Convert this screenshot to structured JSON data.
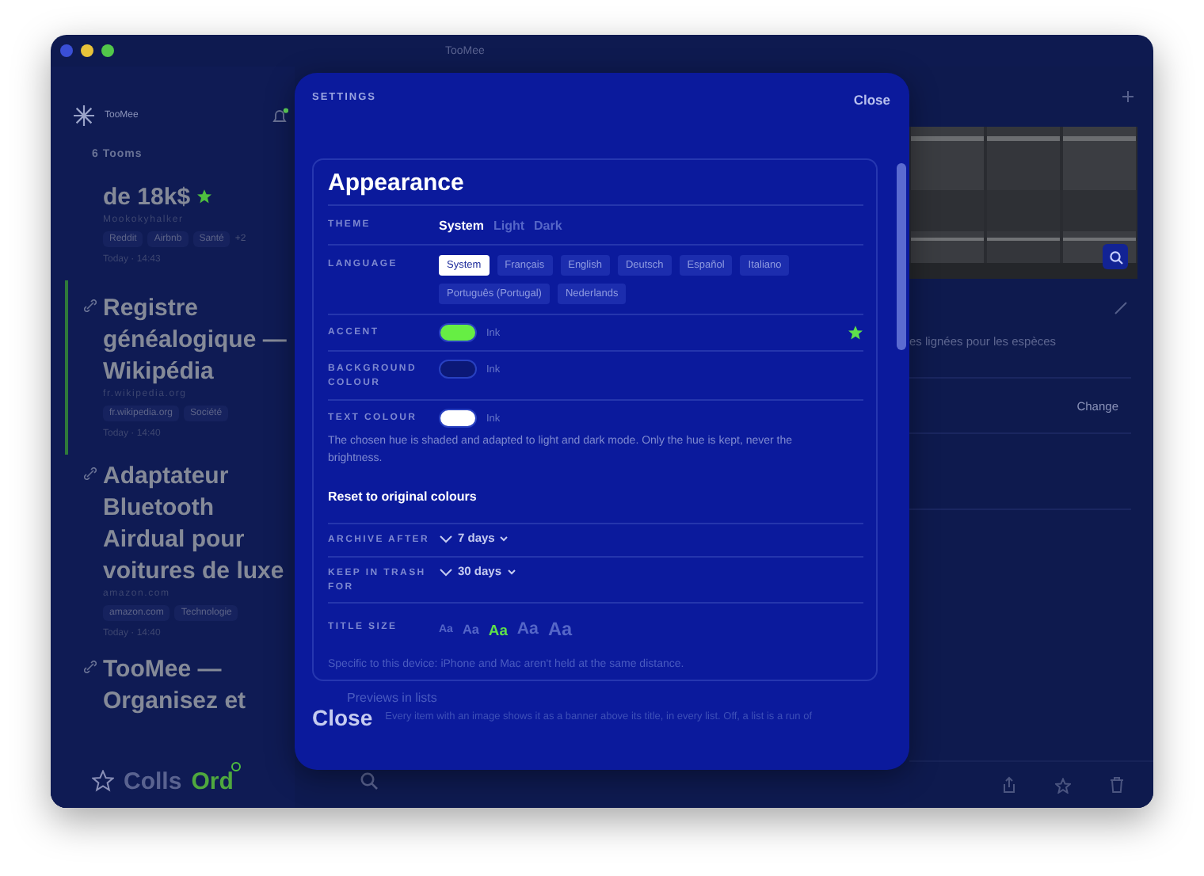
{
  "window": {
    "title": "TooMee"
  },
  "sidebar": {
    "app_name": "TooMee",
    "notification": true,
    "count": "6 Tooms",
    "items": [
      {
        "title": "de 18k$",
        "starred": true,
        "source": "Mookokyhalker",
        "tags": [
          "Reddit",
          "Airbnb",
          "Santé",
          "+2"
        ],
        "time": "Today · 14:43",
        "selected": false
      },
      {
        "title": "Registre généalogique — Wikipédia",
        "starred": false,
        "source": "fr.wikipedia.org",
        "tags": [
          "fr.wikipedia.org",
          "Société"
        ],
        "time": "Today · 14:40",
        "selected": true
      },
      {
        "title": "Adaptateur Bluetooth Airdual pour voitures de luxe",
        "starred": false,
        "source": "amazon.com",
        "tags": [
          "amazon.com",
          "Technologie"
        ],
        "time": "Today · 14:40",
        "selected": false
      },
      {
        "title": "TooMee — Organisez et",
        "starred": false,
        "selected": false
      }
    ],
    "tabs": [
      {
        "label": "Colls",
        "selected": false,
        "badge": false
      },
      {
        "label": "Ord",
        "selected": true,
        "badge": true
      }
    ]
  },
  "detail": {
    "text": "es lignées pour les espèces",
    "action": "Change"
  },
  "settings": {
    "title": "SETTINGS",
    "close": "Close",
    "section": "Appearance",
    "theme": {
      "label": "THEME",
      "options": [
        {
          "label": "System",
          "selected": true
        },
        {
          "label": "Light",
          "selected": false
        },
        {
          "label": "Dark",
          "selected": false
        }
      ]
    },
    "language": {
      "label": "LANGUAGE",
      "options": [
        {
          "label": "System",
          "selected": true
        },
        {
          "label": "Français",
          "selected": false
        },
        {
          "label": "English",
          "selected": false
        },
        {
          "label": "Deutsch",
          "selected": false
        },
        {
          "label": "Español",
          "selected": false
        },
        {
          "label": "Italiano",
          "selected": false
        },
        {
          "label": "Português (Portugal)",
          "selected": false
        },
        {
          "label": "Nederlands",
          "selected": false
        }
      ]
    },
    "colours": [
      {
        "label": "ACCENT",
        "color": "#66ee44",
        "value": "Ink",
        "starred": true
      },
      {
        "label": "BACKGROUND COLOUR",
        "color": "#0b1877",
        "value": "Ink",
        "starred": false
      },
      {
        "label": "TEXT COLOUR",
        "color": "#ffffff",
        "value": "Ink",
        "starred": false
      }
    ],
    "colour_note": "The chosen hue is shaded and adapted to light and dark mode. Only the hue is kept, never the brightness.",
    "reset": "Reset to original colours",
    "pickers": [
      {
        "label": "ARCHIVE AFTER",
        "value": "7 days"
      },
      {
        "label": "KEEP IN TRASH FOR",
        "value": "30 days"
      }
    ],
    "title_size": {
      "label": "TITLE SIZE",
      "options": [
        {
          "label": "Aa",
          "selected": false
        },
        {
          "label": "Aa",
          "selected": false
        },
        {
          "label": "Aa",
          "selected": true
        },
        {
          "label": "Aa",
          "selected": false
        },
        {
          "label": "Aa",
          "selected": false
        }
      ]
    },
    "title_size_note": "Specific to this device: iPhone and Mac aren't held at the same distance.",
    "previews": {
      "label": "Previews in lists",
      "note": "Every item with an image shows it as a banner above its title, in every list. Off, a list is a run of"
    },
    "footer_close": "Close"
  }
}
